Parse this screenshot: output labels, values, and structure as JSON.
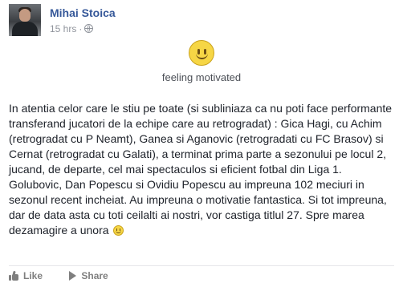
{
  "post": {
    "author": "Mihai Stoica",
    "timestamp": "15 hrs",
    "separator": "·",
    "privacy_icon": "globe-icon",
    "avatar_icon": "profile-photo"
  },
  "feeling": {
    "emoji": "smiley-icon",
    "text": "feeling motivated"
  },
  "body": {
    "paragraph_1": "In atentia celor care le stiu pe toate (si subliniaza ca nu poti face performante transferand jucatori de la echipe care au retrogradat) : Gica Hagi, cu Achim (retrogradat cu P Neamt), Ganea si Aganovic (retrogradati cu FC Brasov) si Cernat (retrogradat cu Galati), a terminat prima parte a sezonului pe locul 2, jucand, de departe, cel mai spectaculos si eficient fotbal din Liga 1.",
    "paragraph_2": "Golubovic, Dan Popescu si Ovidiu Popescu au impreuna 102 meciuri in sezonul recent incheiat. Au impreuna o motivatie fantastica. Si tot impreuna, dar de data asta cu toti ceilalti ai nostri, vor castiga titlul 27. Spre marea dezamagire a unora"
  },
  "actions": {
    "like_label": "Like",
    "share_label": "Share"
  },
  "colors": {
    "author_link": "#365899",
    "meta_text": "#90949c",
    "body_text": "#1d2129",
    "action_text": "#7f7f7f",
    "emoji_yellow": "#f6d645"
  }
}
